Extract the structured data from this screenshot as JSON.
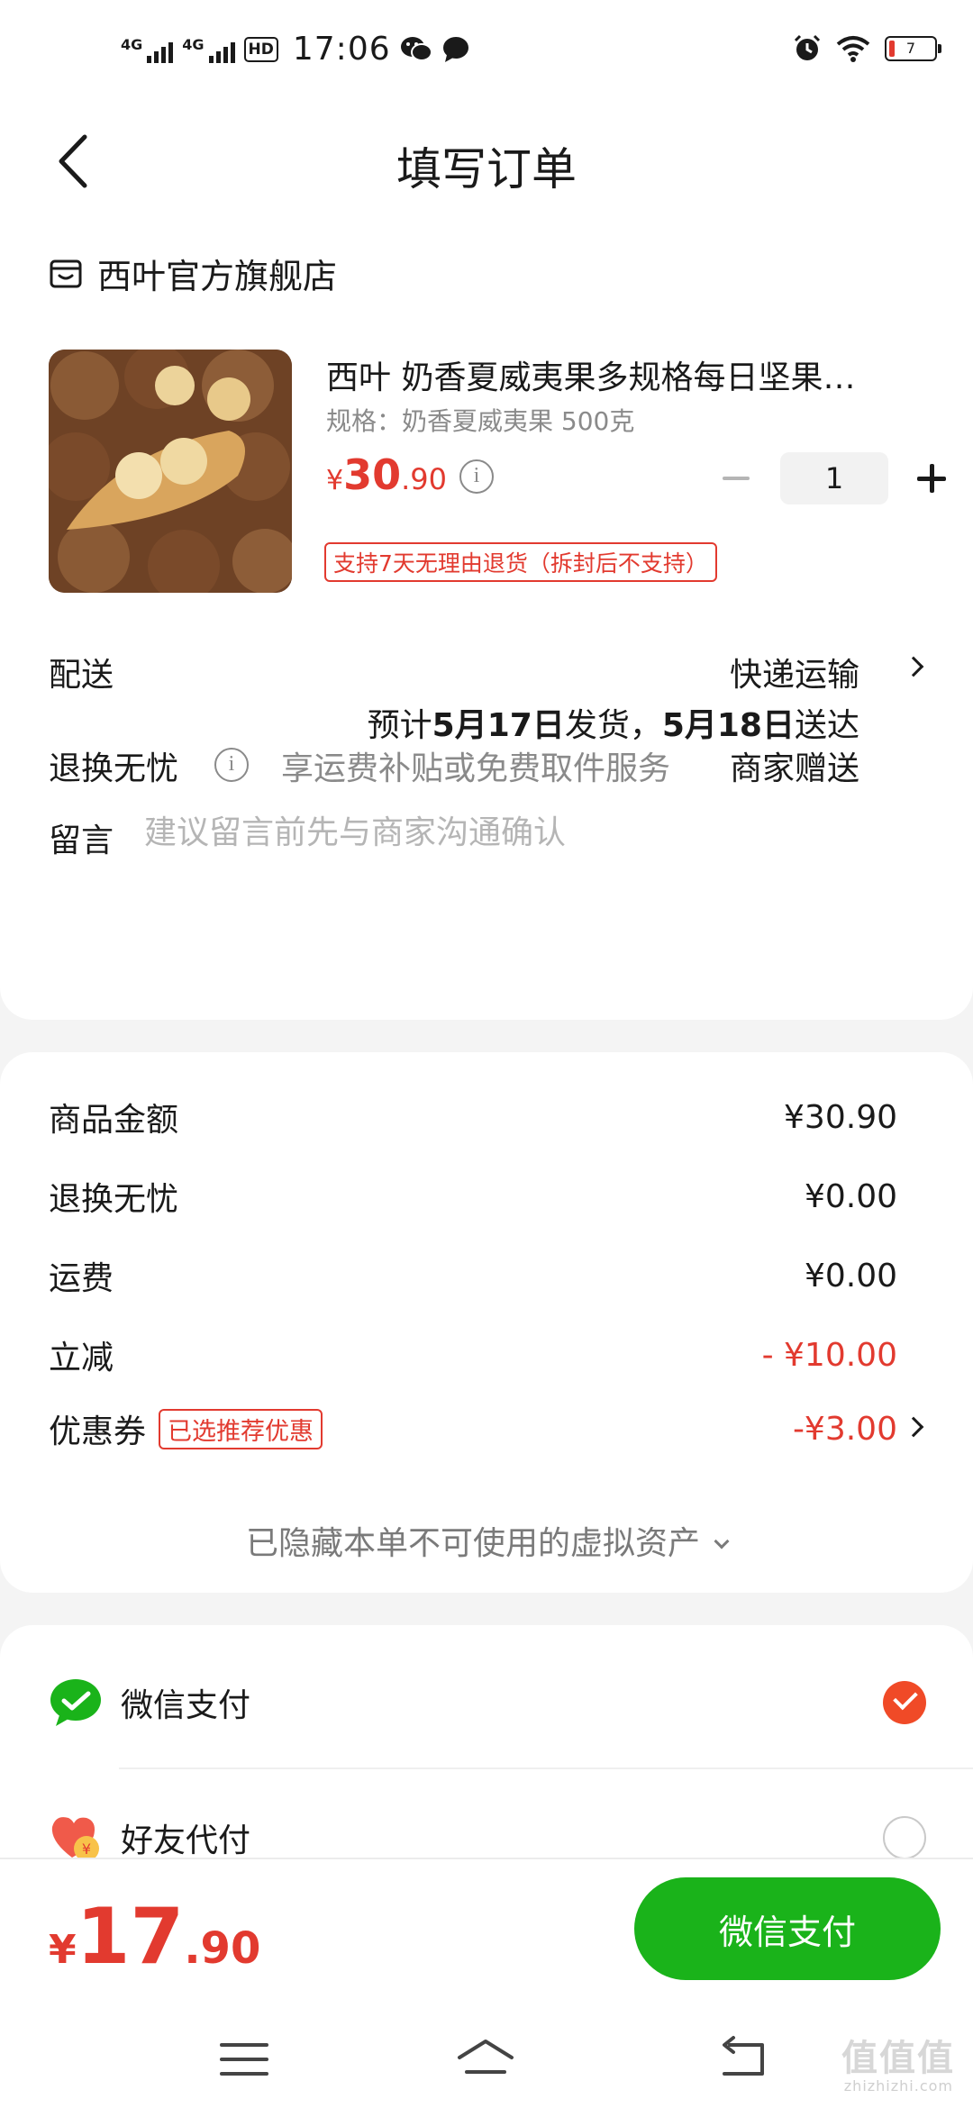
{
  "status_bar": {
    "network1": "4G",
    "network2": "4G",
    "hd_label": "HD",
    "time": "17:06",
    "battery_level": "7"
  },
  "header": {
    "title": "填写订单"
  },
  "store": {
    "name": "西叶官方旗舰店"
  },
  "product": {
    "title": "西叶 奶香夏威夷果多规格每日坚果…",
    "spec": "规格：奶香夏威夷果 500克",
    "price_currency": "¥",
    "price_int": "30",
    "price_dec": ".90",
    "quantity": "1",
    "return_badge": "支持7天无理由退货（拆封后不支持）"
  },
  "delivery": {
    "label": "配送",
    "method": "快递运输",
    "eta_prefix": "预计",
    "eta_ship": "5月17日",
    "eta_mid": "发货，",
    "eta_arrive": "5月18日",
    "eta_suffix": "送达"
  },
  "worry_free": {
    "label": "退换无忧",
    "desc": "享运费补贴或免费取件服务",
    "value": "商家赠送"
  },
  "message": {
    "label": "留言",
    "placeholder": "建议留言前先与商家沟通确认"
  },
  "costs": {
    "goods_label": "商品金额",
    "goods_value": "¥30.90",
    "worry_label": "退换无忧",
    "worry_value": "¥0.00",
    "shipping_label": "运费",
    "shipping_value": "¥0.00",
    "discount_label": "立减",
    "discount_value": "- ¥10.00",
    "coupon_label": "优惠券",
    "coupon_badge": "已选推荐优惠",
    "coupon_value": "-¥3.00",
    "hidden_assets": "已隐藏本单不可使用的虚拟资产"
  },
  "payment": {
    "options": [
      {
        "label": "微信支付",
        "selected": true
      },
      {
        "label": "好友代付",
        "selected": false
      }
    ]
  },
  "footer": {
    "total_currency": "¥",
    "total_int": "17",
    "total_dec": ".90",
    "pay_button": "微信支付"
  },
  "watermark": {
    "text": "值值值",
    "sub": "zhizhizhi.com"
  },
  "colors": {
    "accent_red": "#e23a2f",
    "wechat_green": "#1ab31a",
    "check_orange": "#f04a27"
  }
}
